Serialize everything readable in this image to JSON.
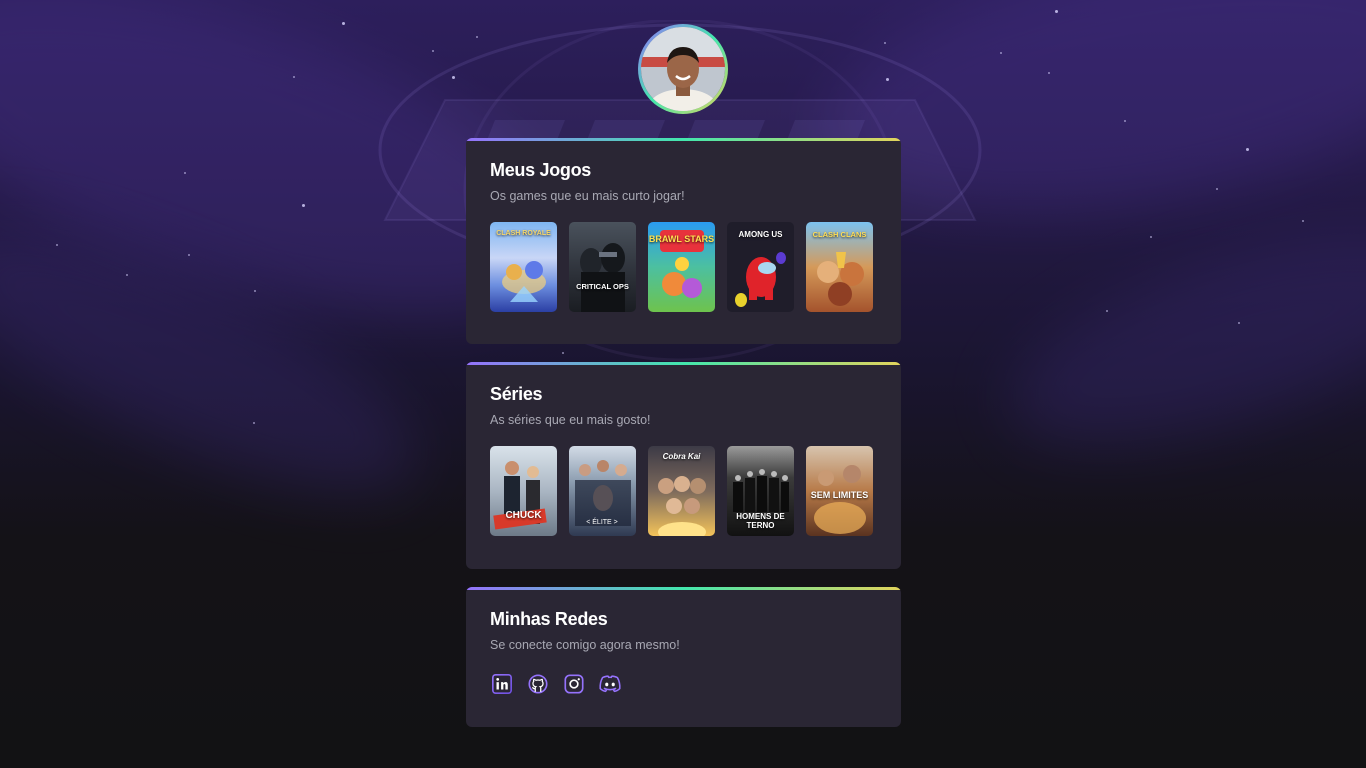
{
  "profile": {
    "avatar_alt": "profile photo"
  },
  "games": {
    "title": "Meus Jogos",
    "subtitle": "Os games que eu mais curto jogar!",
    "items": [
      {
        "name": "Clash Royale",
        "caption": "CLASH ROYALE"
      },
      {
        "name": "Critical Ops",
        "caption": "CRITICAL OPS"
      },
      {
        "name": "Brawl Stars",
        "caption": "BRAWL STARS"
      },
      {
        "name": "Among Us",
        "caption": "AMONG US"
      },
      {
        "name": "Clash of Clans",
        "caption": "CLASH CLANS"
      }
    ]
  },
  "series": {
    "title": "Séries",
    "subtitle": "As séries que eu mais gosto!",
    "items": [
      {
        "name": "Chuck",
        "caption": "CHUCK"
      },
      {
        "name": "Elite",
        "caption": ""
      },
      {
        "name": "Cobra Kai",
        "caption": "Cobra Kai"
      },
      {
        "name": "Homens de Terno",
        "caption": "HOMENS DE TERNO"
      },
      {
        "name": "Sem Limites",
        "caption": "SEM LIMITES"
      }
    ]
  },
  "networks": {
    "title": "Minhas Redes",
    "subtitle": "Se conecte comigo agora mesmo!",
    "items": [
      {
        "icon": "linkedin-icon"
      },
      {
        "icon": "github-icon"
      },
      {
        "icon": "instagram-icon"
      },
      {
        "icon": "discord-icon"
      }
    ]
  },
  "colors": {
    "accent_purple": "#9572fc",
    "accent_green": "#43e7ad",
    "accent_yellow": "#e2d45c",
    "card_bg": "#2a2634",
    "text_muted": "#a8a8b3"
  }
}
